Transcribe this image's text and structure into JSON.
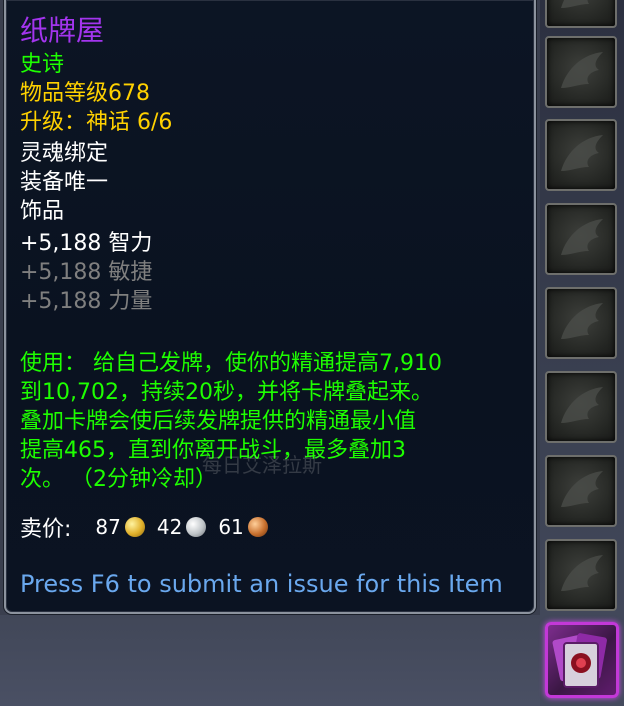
{
  "item": {
    "name": "纸牌屋",
    "quality": "史诗",
    "item_level": "物品等级678",
    "upgrade": "升级：神话 6/6",
    "binding": "灵魂绑定",
    "unique": "装备唯一",
    "slot": "饰品",
    "stats": [
      "+5,188 智力",
      "+5,188 敏捷",
      "+5,188 力量"
    ],
    "use_lines": [
      "使用： 给自己发牌，使你的精通提高7,910",
      "到10,702，持续20秒，并将卡牌叠起来。",
      "叠加卡牌会使后续发牌提供的精通最小值",
      "提高465，直到你离开战斗，最多叠加3",
      "次。 （2分钟冷却）"
    ],
    "sell_label": "卖价:",
    "sell": {
      "gold": "87",
      "silver": "42",
      "copper": "61"
    },
    "report": "Press F6 to submit an issue for this Item"
  },
  "watermark": "每日艾泽拉斯",
  "colors": {
    "epic": "#a335ee",
    "uncommon": "#1eff00",
    "gold": "#ffd100",
    "disabled": "#7f7f7f",
    "link": "#6aa8ee"
  },
  "icons": [
    "empty-slot-wing-icon",
    "trinket-house-of-cards-icon",
    "gold-coin-icon",
    "silver-coin-icon",
    "copper-coin-icon"
  ]
}
